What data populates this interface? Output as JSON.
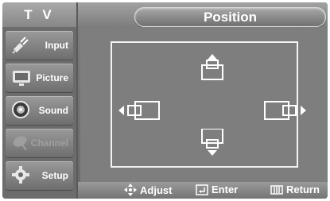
{
  "sidebar": {
    "title": "T V",
    "items": [
      {
        "label": "Input",
        "icon": "input-plug-icon",
        "enabled": true
      },
      {
        "label": "Picture",
        "icon": "picture-monitor-icon",
        "enabled": true
      },
      {
        "label": "Sound",
        "icon": "speaker-icon",
        "enabled": true
      },
      {
        "label": "Channel",
        "icon": "satellite-dish-icon",
        "enabled": false
      },
      {
        "label": "Setup",
        "icon": "gear-icon",
        "enabled": true
      }
    ]
  },
  "header": {
    "title": "Position"
  },
  "position_panel": {
    "controls": [
      "move-up",
      "move-down",
      "move-left",
      "move-right"
    ]
  },
  "footer": {
    "hints": [
      {
        "label": "Adjust",
        "icon": "four-way-arrow-icon"
      },
      {
        "label": "Enter",
        "icon": "enter-icon"
      },
      {
        "label": "Return",
        "icon": "return-icon"
      }
    ]
  },
  "colors": {
    "panel_bg": "#7e7e7e",
    "sidebar_bg": "#6c6c6c",
    "frame_line": "#f3f3f3",
    "text": "#ffffff",
    "disabled_text": "#9f9f9f"
  }
}
